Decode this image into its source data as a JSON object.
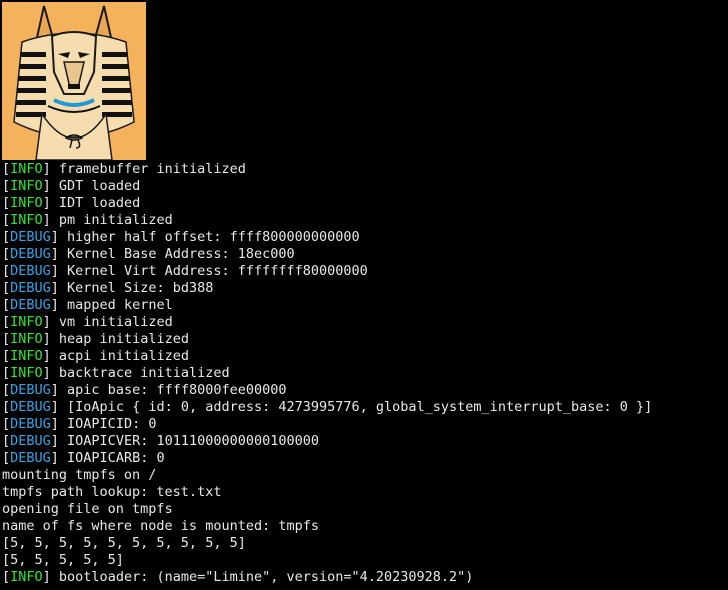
{
  "logo": {
    "icon": "anubis-icon",
    "background": "#f3b25b"
  },
  "colors": {
    "background": "#000000",
    "text": "#e8e8e8",
    "info": "#2ee82e",
    "debug": "#2ea6e8"
  },
  "log": [
    {
      "level": "INFO",
      "message": "framebuffer initialized"
    },
    {
      "level": "INFO",
      "message": "GDT loaded"
    },
    {
      "level": "INFO",
      "message": "IDT loaded"
    },
    {
      "level": "INFO",
      "message": "pm initialized"
    },
    {
      "level": "DEBUG",
      "message": "higher half offset: ffff800000000000"
    },
    {
      "level": "DEBUG",
      "message": "Kernel Base Address: 18ec000"
    },
    {
      "level": "DEBUG",
      "message": "Kernel Virt Address: ffffffff80000000"
    },
    {
      "level": "DEBUG",
      "message": "Kernel Size: bd388"
    },
    {
      "level": "DEBUG",
      "message": "mapped kernel"
    },
    {
      "level": "INFO",
      "message": "vm initialized"
    },
    {
      "level": "INFO",
      "message": "heap initialized"
    },
    {
      "level": "INFO",
      "message": "acpi initialized"
    },
    {
      "level": "INFO",
      "message": "backtrace initialized"
    },
    {
      "level": "DEBUG",
      "message": "apic base: ffff8000fee00000"
    },
    {
      "level": "DEBUG",
      "message": "[IoApic { id: 0, address: 4273995776, global_system_interrupt_base: 0 }]"
    },
    {
      "level": "DEBUG",
      "message": "IOAPICID: 0"
    },
    {
      "level": "DEBUG",
      "message": "IOAPICVER: 10111000000000100000"
    },
    {
      "level": "DEBUG",
      "message": "IOAPICARB: 0"
    },
    {
      "level": "",
      "message": "mounting tmpfs on /"
    },
    {
      "level": "",
      "message": "tmpfs path lookup: test.txt"
    },
    {
      "level": "",
      "message": "opening file on tmpfs"
    },
    {
      "level": "",
      "message": "name of fs where node is mounted: tmpfs"
    },
    {
      "level": "",
      "message": "[5, 5, 5, 5, 5, 5, 5, 5, 5, 5]"
    },
    {
      "level": "",
      "message": "[5, 5, 5, 5, 5]"
    },
    {
      "level": "INFO",
      "message": "bootloader: (name=\"Limine\", version=\"4.20230928.2\")"
    }
  ]
}
